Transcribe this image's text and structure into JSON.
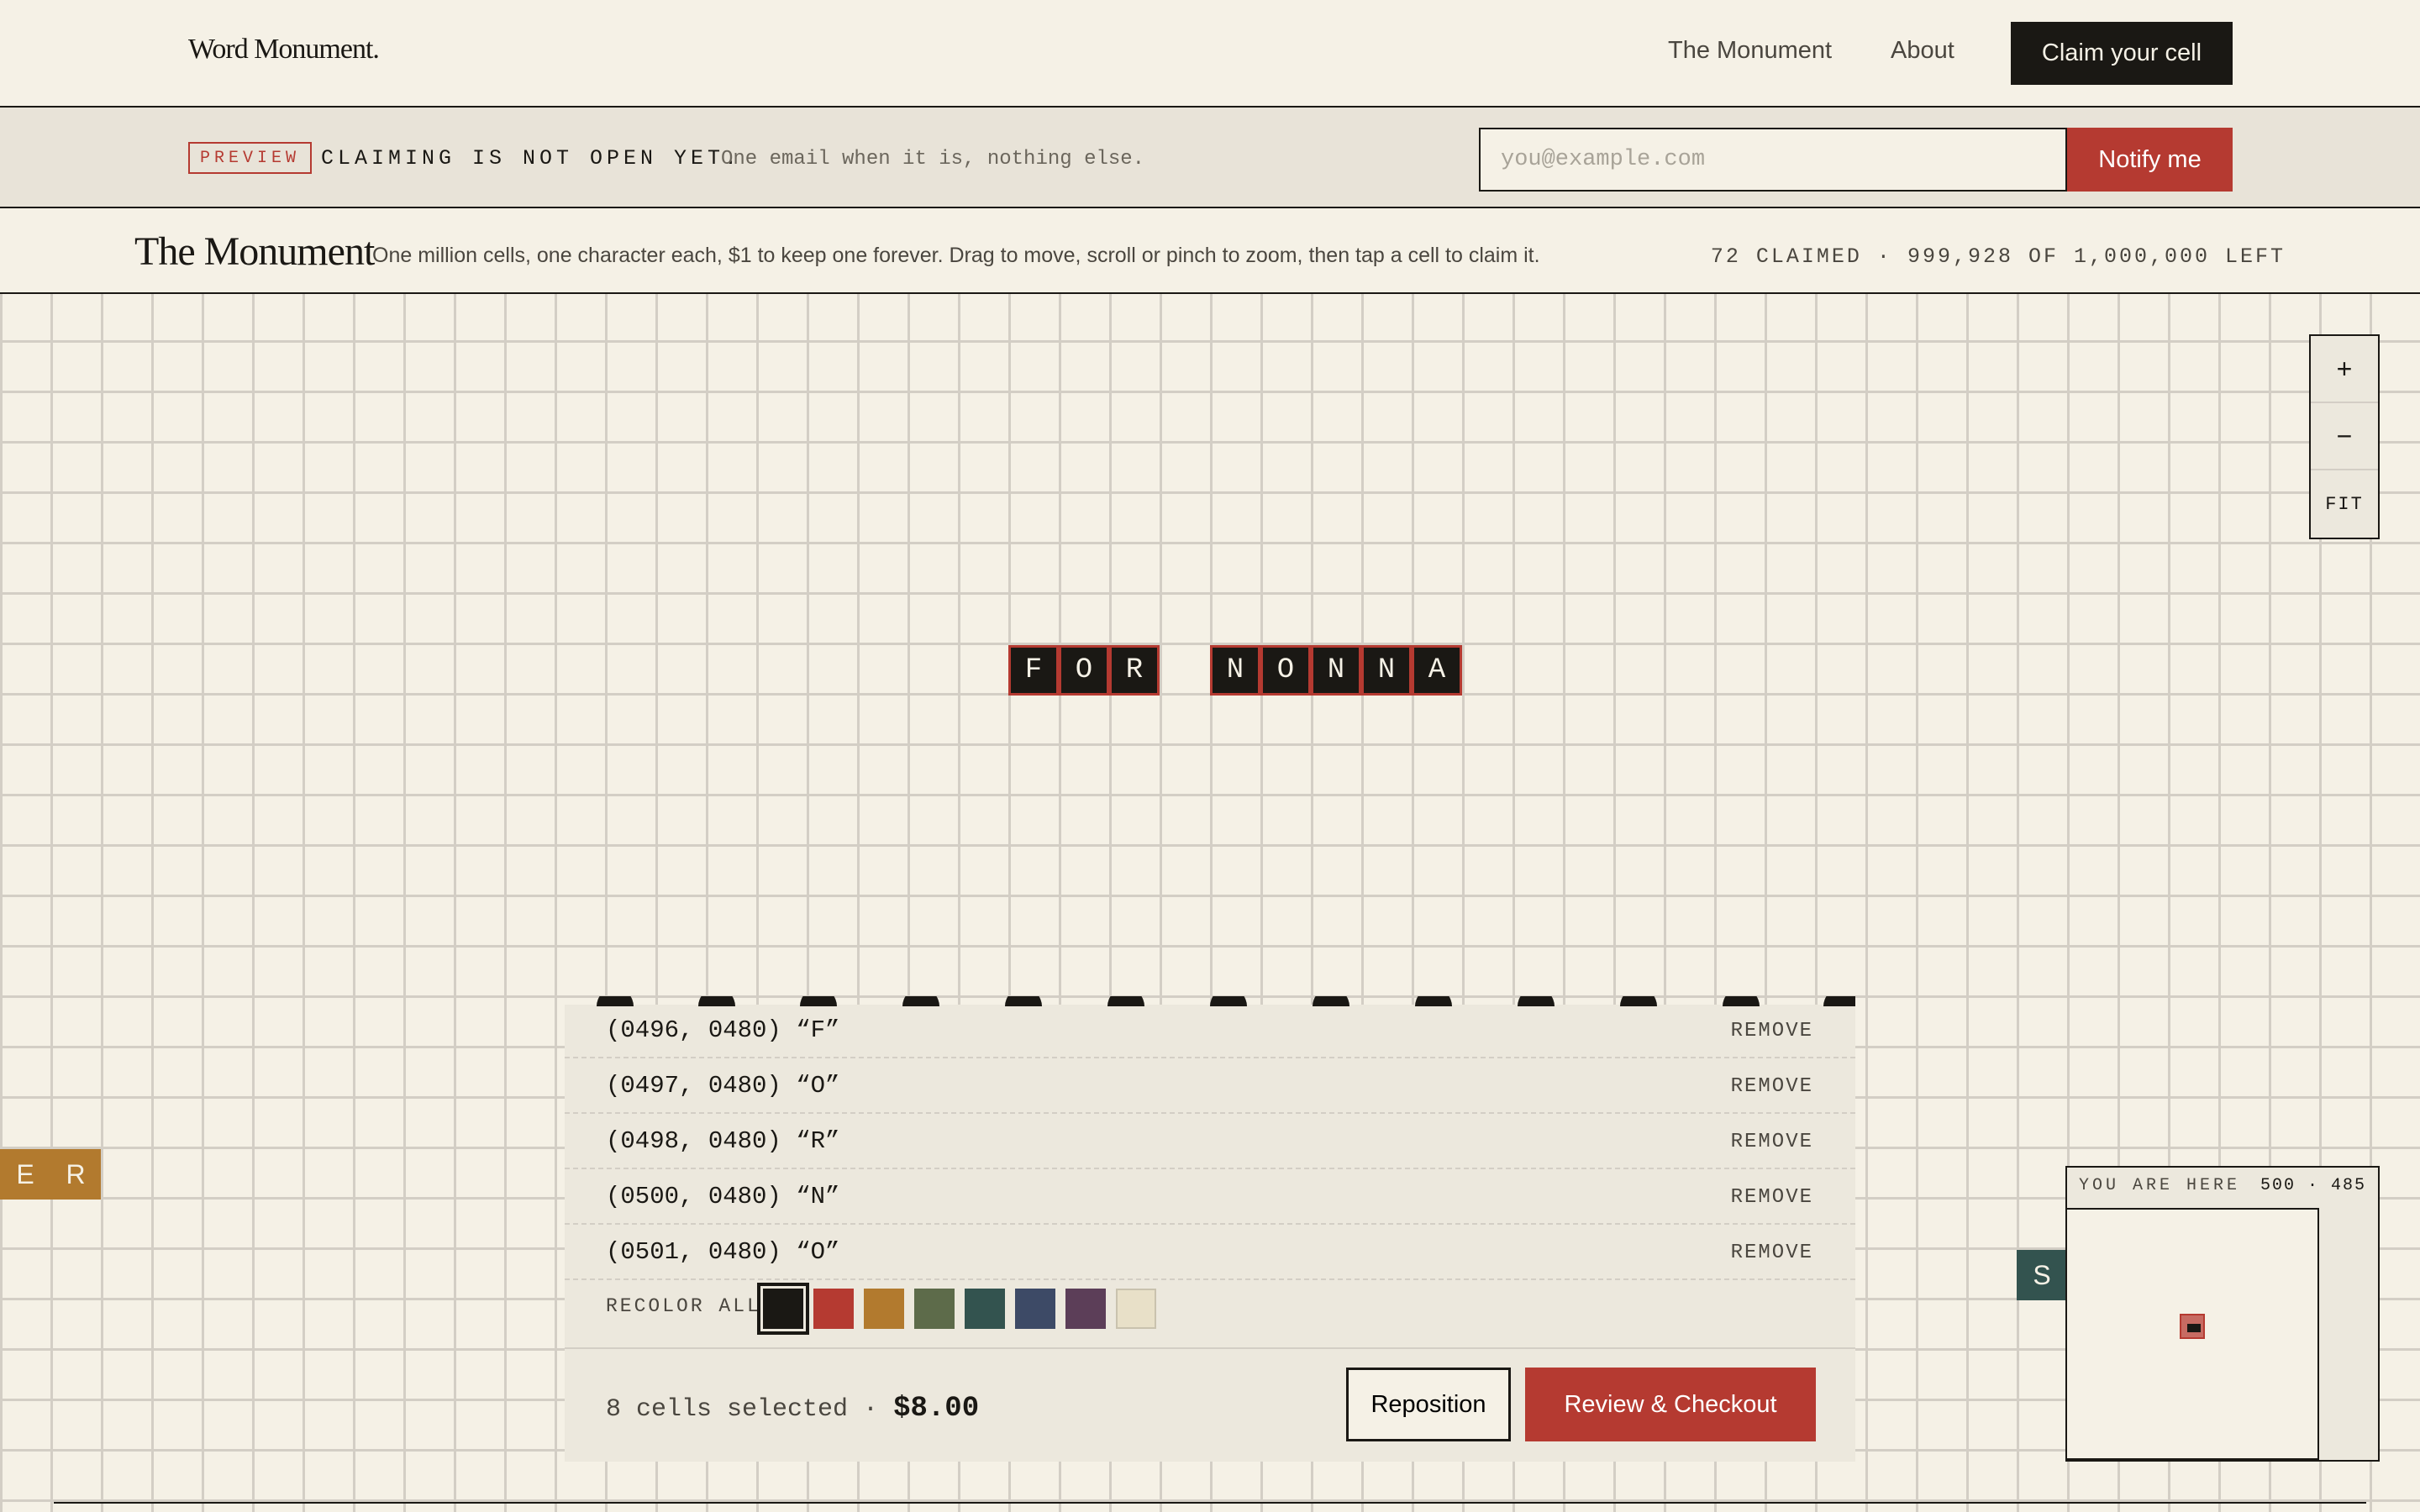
{
  "nav": {
    "logo": "Word Monument.",
    "links": [
      "The Monument",
      "About"
    ],
    "cta": "Claim your cell"
  },
  "banner": {
    "badge": "PREVIEW",
    "headline": "CLAIMING IS NOT OPEN YET.",
    "subtext": "One email when it is, nothing else.",
    "email_placeholder": "you@example.com",
    "email_value": "",
    "button": "Notify me"
  },
  "titlebar": {
    "title": "The Monument",
    "description": "One million cells, one character each, $1 to keep one forever. Drag to move, scroll or pinch to zoom, then tap a cell to claim it.",
    "count": "72 CLAIMED · 999,928 OF 1,000,000 LEFT"
  },
  "canvas": {
    "selected_cells": [
      "F",
      "O",
      "R",
      "N",
      "O",
      "N",
      "N",
      "A"
    ],
    "other_cells": [
      "E",
      "R",
      "S"
    ]
  },
  "zoom": {
    "in": "+",
    "out": "−",
    "fit": "FIT"
  },
  "selection": {
    "rows": [
      {
        "label": "(0496, 0480) “F”",
        "action": "REMOVE"
      },
      {
        "label": "(0497, 0480) “O”",
        "action": "REMOVE"
      },
      {
        "label": "(0498, 0480) “R”",
        "action": "REMOVE"
      },
      {
        "label": "(0500, 0480) “N”",
        "action": "REMOVE"
      },
      {
        "label": "(0501, 0480) “O”",
        "action": "REMOVE"
      }
    ],
    "recolor_label": "RECOLOR ALL",
    "swatches": [
      "#1a1814",
      "#b53a31",
      "#b27a2e",
      "#5d6b4a",
      "#33534f",
      "#3d4a66",
      "#5c3e58",
      "#e8e0c8"
    ],
    "active_swatch": "#1a1814",
    "count_text": "8 cells selected ·",
    "price": "$8.00",
    "reposition": "Reposition",
    "checkout": "Review & Checkout"
  },
  "minimap": {
    "label": "YOU ARE HERE",
    "coords": "500 · 485"
  }
}
